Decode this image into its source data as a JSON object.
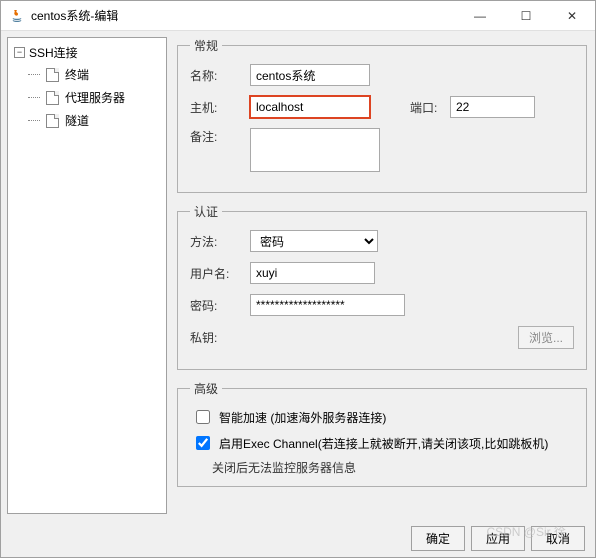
{
  "window": {
    "title": "centos系统-编辑",
    "minimize": "—",
    "maximize": "☐",
    "close": "✕"
  },
  "sidebar": {
    "root": "SSH连接",
    "items": [
      {
        "label": "终端"
      },
      {
        "label": "代理服务器"
      },
      {
        "label": "隧道"
      }
    ]
  },
  "general": {
    "legend": "常规",
    "name_label": "名称:",
    "name_value": "centos系统",
    "host_label": "主机:",
    "host_value": "localhost",
    "port_label": "端口:",
    "port_value": "22",
    "note_label": "备注:",
    "note_value": ""
  },
  "auth": {
    "legend": "认证",
    "method_label": "方法:",
    "method_value": "密码",
    "user_label": "用户名:",
    "user_value": "xuyi",
    "pass_label": "密码:",
    "pass_value": "*******************",
    "key_label": "私钥:",
    "browse": "浏览..."
  },
  "advanced": {
    "legend": "高级",
    "smart_accel": "智能加速 (加速海外服务器连接)",
    "exec_channel": "启用Exec Channel(若连接上就被断开,请关闭该项,比如跳板机)",
    "exec_note": "关闭后无法监控服务器信息"
  },
  "footer": {
    "ok": "确定",
    "apply": "应用",
    "cancel": "取消"
  },
  "watermark": "CSDN @Sir 徐"
}
